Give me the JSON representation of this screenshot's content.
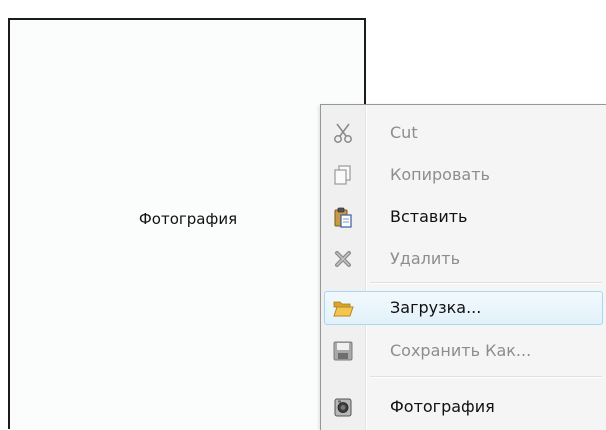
{
  "photo": {
    "label": "Фотография"
  },
  "menu": {
    "items": [
      {
        "label": "Cut",
        "icon": "scissors-icon",
        "enabled": false
      },
      {
        "label": "Копировать",
        "icon": "copy-icon",
        "enabled": false
      },
      {
        "label": "Вставить",
        "icon": "paste-icon",
        "enabled": true
      },
      {
        "label": "Удалить",
        "icon": "delete-icon",
        "enabled": false
      },
      {
        "label": "Загрузка...",
        "icon": "folder-open-icon",
        "enabled": true,
        "highlighted": true
      },
      {
        "label": "Сохранить Как...",
        "icon": "save-icon",
        "enabled": false
      },
      {
        "label": "Фотография",
        "icon": "camera-icon",
        "enabled": true
      }
    ]
  },
  "colors": {
    "highlight_border": "#a8d8f0",
    "disabled_text": "#8d8d8d",
    "folder": "#f0c040"
  }
}
